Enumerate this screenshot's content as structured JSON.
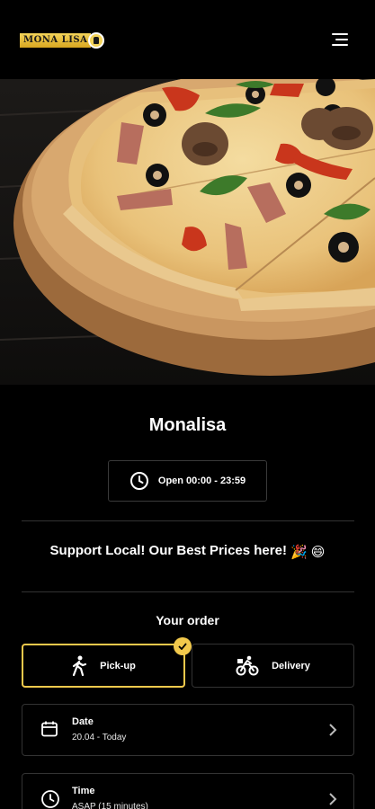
{
  "header": {
    "logo_text": "MONA LISA",
    "logo_icon": "crest-icon",
    "menu_icon": "hamburger-menu-icon"
  },
  "hero": {
    "image": "pizza-photo"
  },
  "shop": {
    "name": "Monalisa",
    "hours_label": "Open 00:00 - 23:59",
    "hours_icon": "clock-icon"
  },
  "promo": {
    "text": "Support Local! Our Best Prices here!",
    "emoji": "🎉 😄"
  },
  "order": {
    "title": "Your order",
    "options": [
      {
        "label": "Pick-up",
        "icon": "walking-person-icon",
        "selected": true
      },
      {
        "label": "Delivery",
        "icon": "bicycle-courier-icon",
        "selected": false
      }
    ],
    "date": {
      "title": "Date",
      "value": "20.04 - Today",
      "icon": "calendar-icon"
    },
    "time": {
      "title": "Time",
      "value": "ASAP (15 minutes)",
      "icon": "clock-icon"
    }
  },
  "colors": {
    "accent": "#f2c94c",
    "background": "#000000",
    "border": "#333333"
  }
}
